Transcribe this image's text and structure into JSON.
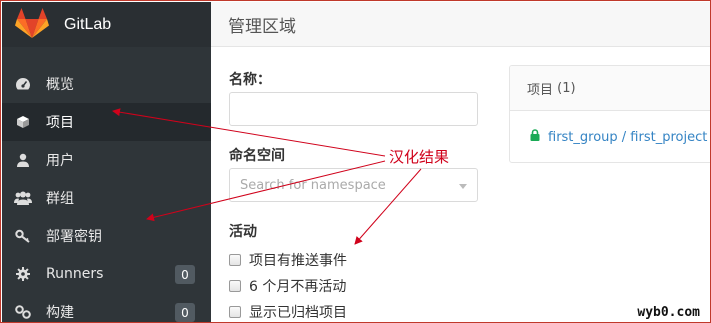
{
  "sidebar": {
    "brand": "GitLab",
    "items": [
      {
        "label": "概览",
        "icon": "dashboard-icon",
        "active": false
      },
      {
        "label": "项目",
        "icon": "cube-icon",
        "active": true
      },
      {
        "label": "用户",
        "icon": "user-icon",
        "active": false
      },
      {
        "label": "群组",
        "icon": "users-icon",
        "active": false
      },
      {
        "label": "部署密钥",
        "icon": "key-icon",
        "active": false
      },
      {
        "label": "Runners",
        "icon": "gear-icon",
        "active": false,
        "badge": "0"
      },
      {
        "label": "构建",
        "icon": "link-icon",
        "active": false,
        "badge": "0"
      }
    ]
  },
  "header": {
    "title": "管理区域"
  },
  "filters": {
    "name_label": "名称：",
    "name_value": "",
    "namespace_label": "命名空间",
    "namespace_placeholder": "Search for namespace",
    "activity_label": "活动",
    "checkboxes": [
      "项目有推送事件",
      "6 个月不再活动",
      "显示已归档项目"
    ]
  },
  "projects_panel": {
    "title": "项目",
    "count": "(1)",
    "project_link": "first_group / first_project"
  },
  "annotation": {
    "text": "汉化结果",
    "color": "#d0021b"
  },
  "watermark": "wyb0.com",
  "colors": {
    "sidebar_bg": "#2f3539",
    "link": "#3584c4",
    "lock": "#1aaa55",
    "annotation": "#d0021b"
  }
}
